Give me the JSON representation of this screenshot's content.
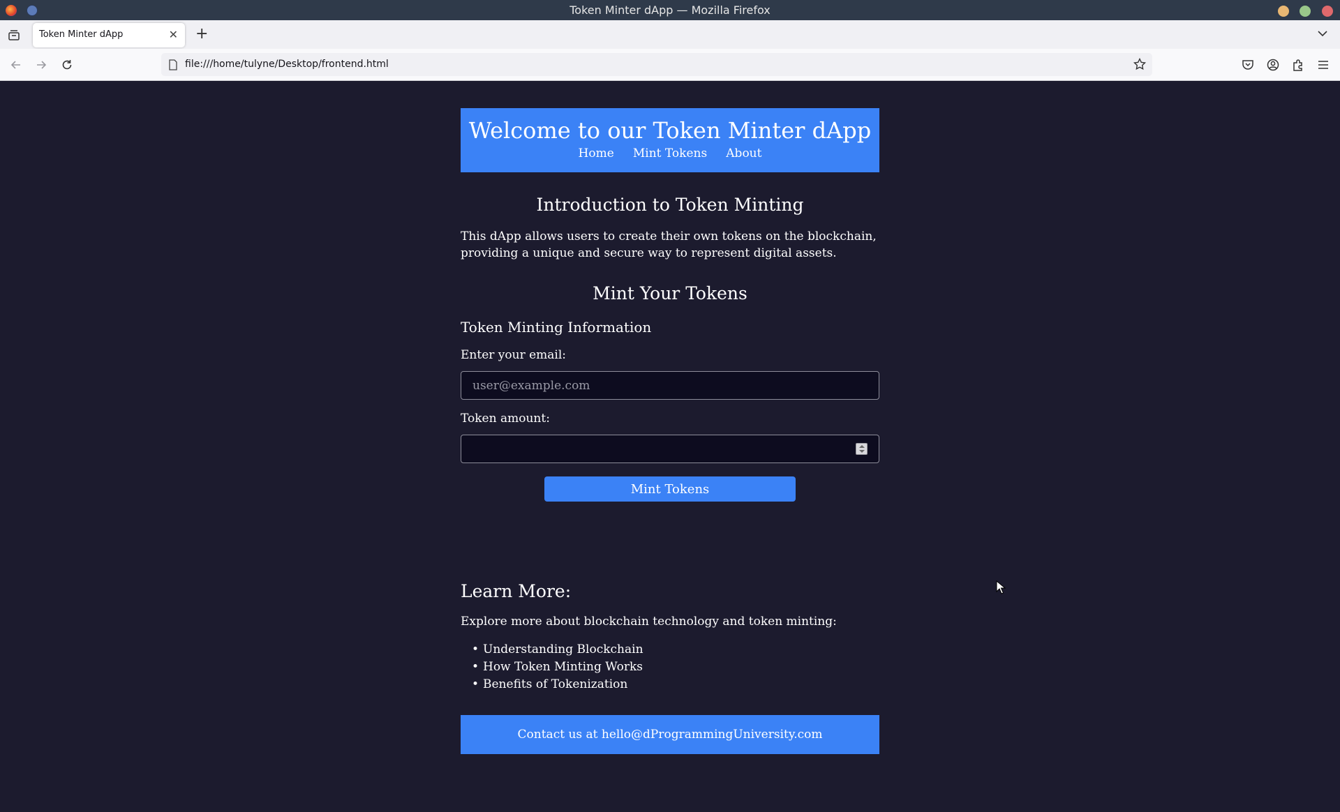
{
  "window": {
    "title": "Token Minter dApp — Mozilla Firefox"
  },
  "browser": {
    "tab_title": "Token Minter dApp",
    "url": "file:///home/tulyne/Desktop/frontend.html",
    "icons": [
      "tab-list-icon",
      "close-icon",
      "plus-icon",
      "chevron-down-icon",
      "back-arrow-icon",
      "forward-arrow-icon",
      "reload-icon",
      "page-icon",
      "star-icon",
      "pocket-icon",
      "account-icon",
      "extensions-icon",
      "menu-icon"
    ]
  },
  "header": {
    "title": "Welcome to our Token Minter dApp",
    "nav": [
      "Home",
      "Mint Tokens",
      "About"
    ]
  },
  "intro": {
    "title": "Introduction to Token Minting",
    "text": "This dApp allows users to create their own tokens on the blockchain, providing a unique and secure way to represent digital assets."
  },
  "mint": {
    "title": "Mint Your Tokens",
    "form_title": "Token Minting Information",
    "email_label": "Enter your email:",
    "email_placeholder": "user@example.com",
    "email_value": "",
    "amount_label": "Token amount:",
    "amount_value": "",
    "button_label": "Mint Tokens"
  },
  "learn": {
    "title": "Learn More:",
    "text": "Explore more about blockchain technology and token minting:",
    "items": [
      "Understanding Blockchain",
      "How Token Minting Works",
      "Benefits of Tokenization"
    ]
  },
  "footer": {
    "text": "Contact us at hello@dProgrammingUniversity.com"
  },
  "colors": {
    "page_background": "#1c1b2e",
    "accent": "#3b82f6",
    "input_background": "#0d0c1f"
  }
}
